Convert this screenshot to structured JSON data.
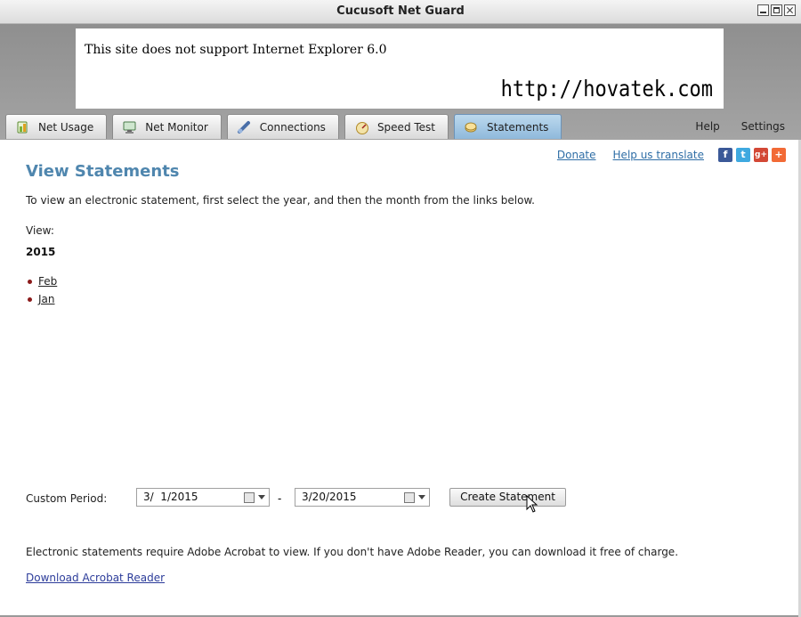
{
  "window": {
    "title": "Cucusoft Net Guard"
  },
  "banner": {
    "message": "This site does not support Internet Explorer 6.0",
    "watermark": "http://hovatek.com"
  },
  "tabs": [
    {
      "label": "Net Usage",
      "icon": "net-usage-icon"
    },
    {
      "label": "Net Monitor",
      "icon": "monitor-icon"
    },
    {
      "label": "Connections",
      "icon": "connections-icon"
    },
    {
      "label": "Speed Test",
      "icon": "speedometer-icon"
    },
    {
      "label": "Statements",
      "icon": "statements-icon",
      "active": true
    }
  ],
  "toplinks": {
    "help": "Help",
    "settings": "Settings"
  },
  "header_links": {
    "donate": "Donate",
    "translate": "Help us translate"
  },
  "social": [
    {
      "name": "facebook-icon",
      "glyph": "f",
      "color": "#3b5998"
    },
    {
      "name": "twitter-icon",
      "glyph": "t",
      "color": "#3fa9e0"
    },
    {
      "name": "google-plus-icon",
      "glyph": "g+",
      "color": "#d34836"
    },
    {
      "name": "share-add-icon",
      "glyph": "+",
      "color": "#f26a36"
    }
  ],
  "page": {
    "title": "View Statements",
    "intro": "To view an electronic statement, first select the year, and then the month from the links below.",
    "view_label": "View:",
    "year": "2015",
    "months": [
      "Feb",
      "Jan"
    ]
  },
  "custom": {
    "label": "Custom Period:",
    "start": "3/  1/2015",
    "separator": "-",
    "end": "3/20/2015",
    "button": "Create Statement"
  },
  "footer": {
    "note": "Electronic statements require Adobe Acrobat to view. If you don't have Adobe Reader, you can download it free of charge.",
    "download": "Download Acrobat Reader"
  }
}
